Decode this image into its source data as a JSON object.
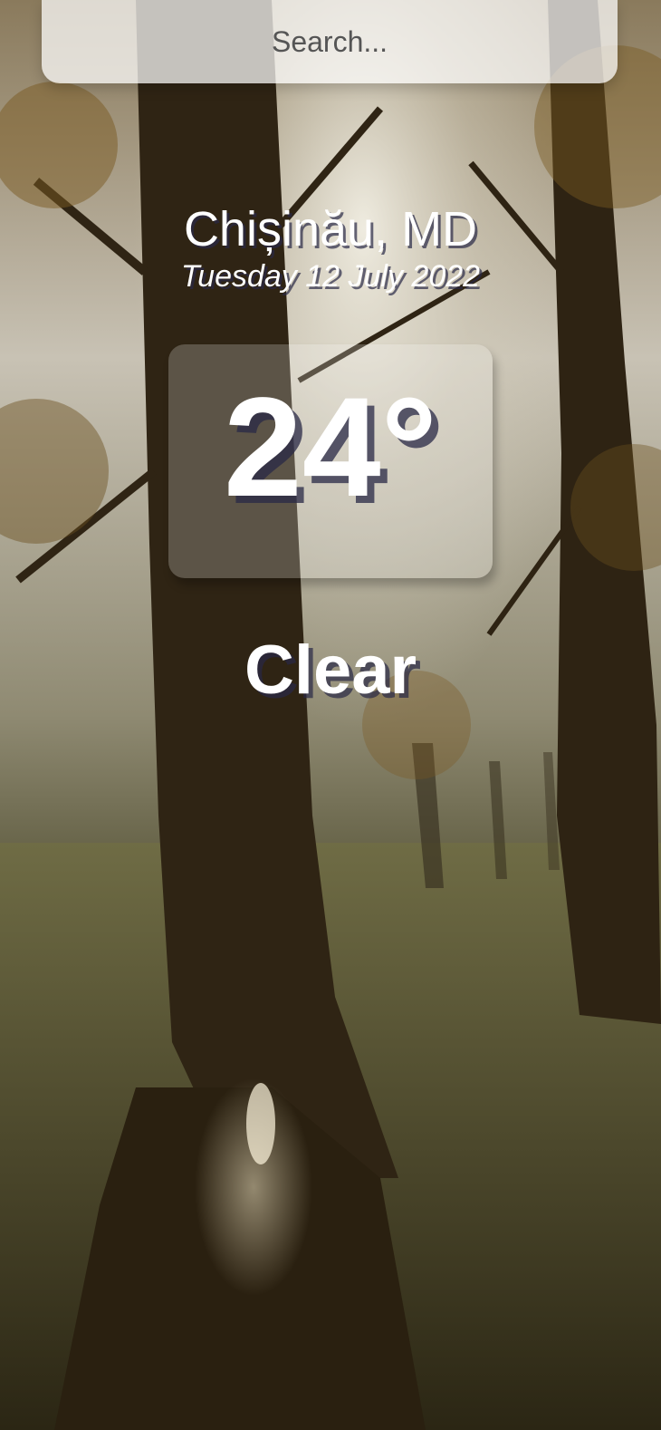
{
  "search": {
    "placeholder": "Search..."
  },
  "weather": {
    "location": "Chișinău, MD",
    "date": "Tuesday 12 July 2022",
    "temperature": "24°",
    "condition": "Clear"
  },
  "background": {
    "scene": "autumn forest with trees and sunlight"
  }
}
